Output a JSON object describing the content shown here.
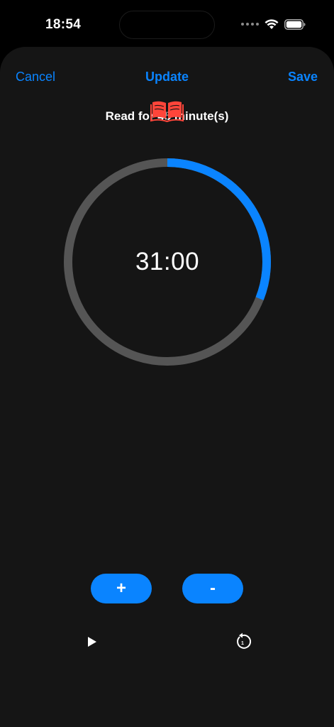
{
  "status_bar": {
    "time": "18:54",
    "icons": [
      "signal-dots-icon",
      "wifi-icon",
      "battery-icon"
    ]
  },
  "nav": {
    "cancel_label": "Cancel",
    "title_label": "Update",
    "save_label": "Save"
  },
  "task": {
    "title": "Read for 45 minute(s)",
    "icon": "book-icon",
    "icon_color": "#ff3b30"
  },
  "timer": {
    "display": "31:00",
    "progress_fraction": 0.31,
    "progress_color": "#0a84ff",
    "track_color": "#555555"
  },
  "adjust": {
    "plus_label": "+",
    "minus_label": "-"
  },
  "controls": {
    "play_icon": "play-icon",
    "reset_icon": "reset-icon"
  },
  "colors": {
    "accent": "#0a84ff",
    "sheet_background": "#151515",
    "screen_background": "#000000"
  }
}
